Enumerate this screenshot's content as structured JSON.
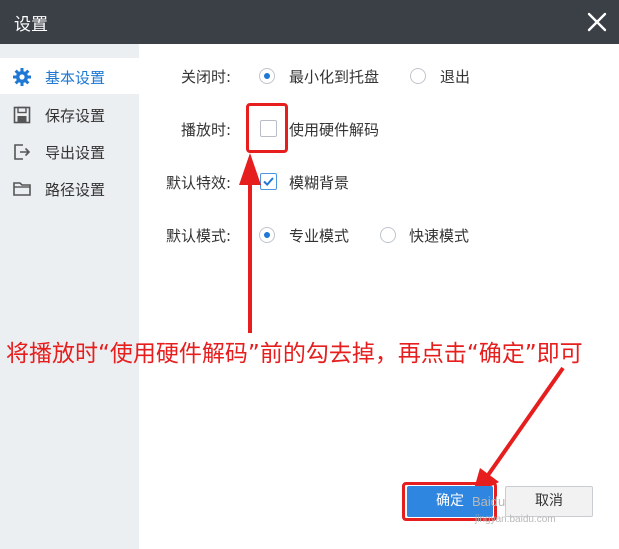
{
  "window": {
    "title": "设置"
  },
  "sidebar": {
    "items": [
      {
        "label": "基本设置",
        "icon": "gear-icon",
        "active": true
      },
      {
        "label": "保存设置",
        "icon": "save-icon",
        "active": false
      },
      {
        "label": "导出设置",
        "icon": "export-icon",
        "active": false
      },
      {
        "label": "路径设置",
        "icon": "folder-icon",
        "active": false
      }
    ]
  },
  "settings": {
    "close_label": "关闭时:",
    "close_options": [
      "最小化到托盘",
      "退出"
    ],
    "close_selected": "最小化到托盘",
    "playback_label": "播放时:",
    "playback_option": "使用硬件解码",
    "playback_checked": false,
    "effect_label": "默认特效:",
    "effect_option": "模糊背景",
    "effect_checked": true,
    "mode_label": "默认模式:",
    "mode_options": [
      "专业模式",
      "快速模式"
    ],
    "mode_selected": "专业模式"
  },
  "annotation": {
    "text": "将播放时“使用硬件解码”前的勾去掉，再点击“确定”即可",
    "color": "#e61e1e"
  },
  "footer": {
    "ok_label": "确定",
    "cancel_label": "取消"
  },
  "watermark": {
    "line1": "Baidu",
    "line2": "jingyan.baidu.com"
  },
  "colors": {
    "accent": "#1e78d4",
    "titlebar": "#3b3f46",
    "sidebar": "#eceff2"
  }
}
